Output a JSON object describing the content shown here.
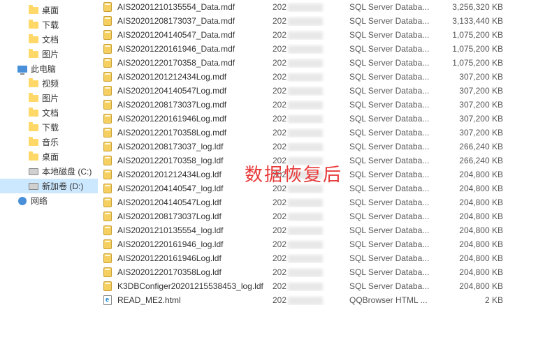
{
  "overlay": "数据恢复后",
  "sidebar": {
    "items": [
      {
        "label": "桌面",
        "icon": "folder",
        "indent": true
      },
      {
        "label": "下载",
        "icon": "folder",
        "indent": true
      },
      {
        "label": "文档",
        "icon": "folder",
        "indent": true
      },
      {
        "label": "图片",
        "icon": "folder",
        "indent": true
      },
      {
        "label": "此电脑",
        "icon": "pc",
        "indent": false
      },
      {
        "label": "视频",
        "icon": "folder",
        "indent": true
      },
      {
        "label": "图片",
        "icon": "folder",
        "indent": true
      },
      {
        "label": "文档",
        "icon": "folder",
        "indent": true
      },
      {
        "label": "下载",
        "icon": "folder",
        "indent": true
      },
      {
        "label": "音乐",
        "icon": "folder",
        "indent": true
      },
      {
        "label": "桌面",
        "icon": "folder",
        "indent": true
      },
      {
        "label": "本地磁盘 (C:)",
        "icon": "disk",
        "indent": true
      },
      {
        "label": "新加卷 (D:)",
        "icon": "disk",
        "indent": true,
        "selected": true
      },
      {
        "label": "网络",
        "icon": "net",
        "indent": false
      }
    ]
  },
  "files": [
    {
      "name": "AIS20201210135554_Data.mdf",
      "date": "202",
      "type": "SQL Server Databa...",
      "size": "3,256,320 KB",
      "ico": "db"
    },
    {
      "name": "AIS20201208173037_Data.mdf",
      "date": "202",
      "type": "SQL Server Databa...",
      "size": "3,133,440 KB",
      "ico": "db"
    },
    {
      "name": "AIS20201204140547_Data.mdf",
      "date": "202",
      "type": "SQL Server Databa...",
      "size": "1,075,200 KB",
      "ico": "db"
    },
    {
      "name": "AIS20201220161946_Data.mdf",
      "date": "202",
      "type": "SQL Server Databa...",
      "size": "1,075,200 KB",
      "ico": "db"
    },
    {
      "name": "AIS20201220170358_Data.mdf",
      "date": "202",
      "type": "SQL Server Databa...",
      "size": "1,075,200 KB",
      "ico": "db"
    },
    {
      "name": "AIS20201201212434Log.mdf",
      "date": "202",
      "type": "SQL Server Databa...",
      "size": "307,200 KB",
      "ico": "db"
    },
    {
      "name": "AIS20201204140547Log.mdf",
      "date": "202",
      "type": "SQL Server Databa...",
      "size": "307,200 KB",
      "ico": "db"
    },
    {
      "name": "AIS20201208173037Log.mdf",
      "date": "202",
      "type": "SQL Server Databa...",
      "size": "307,200 KB",
      "ico": "db"
    },
    {
      "name": "AIS20201220161946Log.mdf",
      "date": "202",
      "type": "SQL Server Databa...",
      "size": "307,200 KB",
      "ico": "db"
    },
    {
      "name": "AIS20201220170358Log.mdf",
      "date": "202",
      "type": "SQL Server Databa...",
      "size": "307,200 KB",
      "ico": "db"
    },
    {
      "name": "AIS20201208173037_log.ldf",
      "date": "202",
      "type": "SQL Server Databa...",
      "size": "266,240 KB",
      "ico": "db"
    },
    {
      "name": "AIS20201220170358_log.ldf",
      "date": "202",
      "type": "SQL Server Databa...",
      "size": "266,240 KB",
      "ico": "db"
    },
    {
      "name": "AIS20201201212434Log.ldf",
      "date": "202",
      "type": "SQL Server Databa...",
      "size": "204,800 KB",
      "ico": "db"
    },
    {
      "name": "AIS20201204140547_log.ldf",
      "date": "202",
      "type": "SQL Server Databa...",
      "size": "204,800 KB",
      "ico": "db"
    },
    {
      "name": "AIS20201204140547Log.ldf",
      "date": "202",
      "type": "SQL Server Databa...",
      "size": "204,800 KB",
      "ico": "db"
    },
    {
      "name": "AIS20201208173037Log.ldf",
      "date": "202",
      "type": "SQL Server Databa...",
      "size": "204,800 KB",
      "ico": "db"
    },
    {
      "name": "AIS20201210135554_log.ldf",
      "date": "202",
      "type": "SQL Server Databa...",
      "size": "204,800 KB",
      "ico": "db"
    },
    {
      "name": "AIS20201220161946_log.ldf",
      "date": "202",
      "type": "SQL Server Databa...",
      "size": "204,800 KB",
      "ico": "db"
    },
    {
      "name": "AIS20201220161946Log.ldf",
      "date": "202",
      "type": "SQL Server Databa...",
      "size": "204,800 KB",
      "ico": "db"
    },
    {
      "name": "AIS20201220170358Log.ldf",
      "date": "202",
      "type": "SQL Server Databa...",
      "size": "204,800 KB",
      "ico": "db"
    },
    {
      "name": "K3DBConfiger20201215538453_log.ldf",
      "date": "202",
      "type": "SQL Server Databa...",
      "size": "204,800 KB",
      "ico": "db"
    },
    {
      "name": "READ_ME2.html",
      "date": "202",
      "type": "QQBrowser HTML ...",
      "size": "2 KB",
      "ico": "html"
    }
  ]
}
